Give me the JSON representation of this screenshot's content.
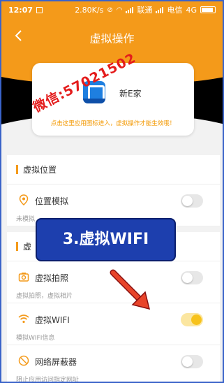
{
  "status_bar": {
    "time": "12:07",
    "speed": "2.80K/s",
    "carrier1": "联通",
    "carrier2": "电信",
    "network": "4G"
  },
  "header": {
    "title": "虚拟操作",
    "back_icon": "back-arrow-icon"
  },
  "app_card": {
    "app_name": "新E家",
    "tip": "点击这里应用图标进入，虚拟操作才能生效哦！",
    "watermark": "微信:57021502"
  },
  "sections": [
    {
      "title": "虚拟位置",
      "items": [
        {
          "label": "位置模拟",
          "sub": "未模拟",
          "icon": "location-pin-icon",
          "enabled": false
        }
      ]
    },
    {
      "title": "虚",
      "items": [
        {
          "label": "虚拟拍照",
          "sub": "虚拟拍照，虚拟相片",
          "icon": "camera-icon",
          "enabled": false
        },
        {
          "label": "虚拟WIFI",
          "sub": "模拟WIFI信息",
          "icon": "wifi-icon",
          "enabled": true
        },
        {
          "label": "网络屏蔽器",
          "sub": "阻止应用访问指定网址",
          "icon": "block-icon",
          "enabled": false
        }
      ]
    }
  ],
  "banner": {
    "text": "3.虚拟WIFI"
  },
  "colors": {
    "accent": "#f49a1a",
    "toggle_on": "#f7c21b",
    "banner": "#1d3fae",
    "watermark": "#e41b1b"
  }
}
